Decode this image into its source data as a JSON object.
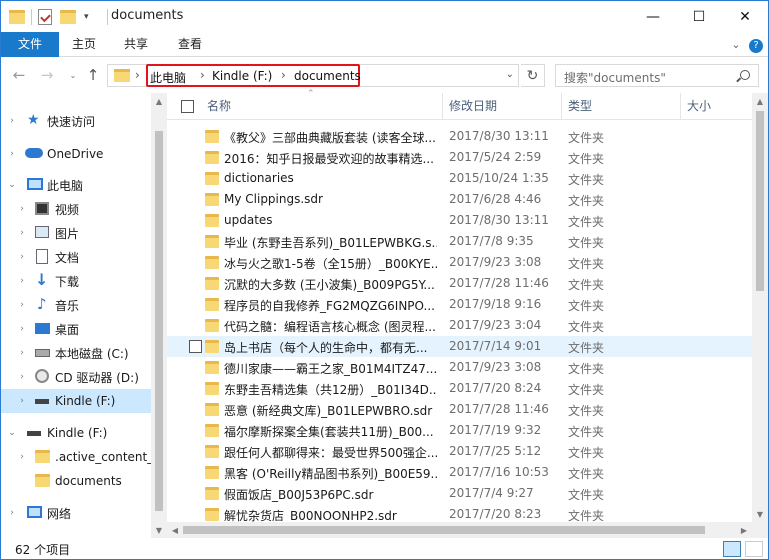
{
  "window": {
    "title": "documents",
    "minimize_glyph": "—",
    "maximize_glyph": "☐",
    "close_glyph": "✕"
  },
  "ribbon": {
    "tabs": [
      "文件",
      "主页",
      "共享",
      "查看"
    ],
    "help_glyph": "?",
    "expand_glyph": "⌄"
  },
  "address": {
    "crumbs": [
      "此电脑",
      "Kindle (F:)",
      "documents"
    ],
    "separator": "›"
  },
  "search": {
    "placeholder": "搜索\"documents\""
  },
  "navpane": {
    "items": [
      {
        "label": "快速访问",
        "icon": "star-icon"
      },
      {
        "label": "OneDrive",
        "icon": "cloud-icon"
      },
      {
        "label": "此电脑",
        "icon": "computer-icon"
      },
      {
        "label": "视频",
        "icon": "video-icon"
      },
      {
        "label": "图片",
        "icon": "picture-icon"
      },
      {
        "label": "文档",
        "icon": "document-icon"
      },
      {
        "label": "下载",
        "icon": "download-icon"
      },
      {
        "label": "音乐",
        "icon": "music-icon"
      },
      {
        "label": "桌面",
        "icon": "desktop-icon"
      },
      {
        "label": "本地磁盘 (C:)",
        "icon": "drive-icon"
      },
      {
        "label": "CD 驱动器 (D:)",
        "icon": "cd-icon"
      },
      {
        "label": "Kindle (F:)",
        "icon": "usb-drive-icon"
      },
      {
        "label": "Kindle (F:)",
        "icon": "usb-drive-icon"
      },
      {
        "label": ".active_content_s",
        "icon": "folder-icon"
      },
      {
        "label": "documents",
        "icon": "folder-icon"
      },
      {
        "label": "网络",
        "icon": "network-icon"
      }
    ]
  },
  "columns": {
    "name": "名称",
    "date": "修改日期",
    "type": "类型",
    "size": "大小"
  },
  "files": [
    {
      "name": "《教父》三部曲典藏版套装 (读客全球...",
      "date": "2017/8/30 13:11",
      "type": "文件夹"
    },
    {
      "name": "2016：知乎日报最受欢迎的故事精选...",
      "date": "2017/5/24 2:59",
      "type": "文件夹"
    },
    {
      "name": "dictionaries",
      "date": "2015/10/24 1:35",
      "type": "文件夹"
    },
    {
      "name": "My Clippings.sdr",
      "date": "2017/6/28 4:46",
      "type": "文件夹"
    },
    {
      "name": "updates",
      "date": "2017/8/30 13:11",
      "type": "文件夹"
    },
    {
      "name": "毕业 (东野圭吾系列)_B01LEPWBKG.s...",
      "date": "2017/7/8 9:35",
      "type": "文件夹"
    },
    {
      "name": "冰与火之歌1-5卷（全15册）_B00KYE...",
      "date": "2017/9/23 3:08",
      "type": "文件夹"
    },
    {
      "name": "沉默的大多数 (王小波集)_B009PG5Y...",
      "date": "2017/7/28 11:46",
      "type": "文件夹"
    },
    {
      "name": "程序员的自我修养_FG2MQZG6INPO...",
      "date": "2017/9/18 9:16",
      "type": "文件夹"
    },
    {
      "name": "代码之髓：编程语言核心概念 (图灵程...",
      "date": "2017/9/23 3:04",
      "type": "文件夹"
    },
    {
      "name": "岛上书店（每个人的生命中，都有无...",
      "date": "2017/7/14 9:01",
      "type": "文件夹"
    },
    {
      "name": "德川家康——霸王之家_B01M4ITZ47...",
      "date": "2017/9/23 3:08",
      "type": "文件夹"
    },
    {
      "name": "东野圭吾精选集（共12册）_B01I34D...",
      "date": "2017/7/20 8:24",
      "type": "文件夹"
    },
    {
      "name": "恶意 (新经典文库)_B01LEPWBRO.sdr",
      "date": "2017/7/28 11:46",
      "type": "文件夹"
    },
    {
      "name": "福尔摩斯探案全集(套装共11册)_B00...",
      "date": "2017/7/19 9:32",
      "type": "文件夹"
    },
    {
      "name": "跟任何人都聊得来：最受世界500强企...",
      "date": "2017/7/25 5:12",
      "type": "文件夹"
    },
    {
      "name": "黑客 (O'Reilly精品图书系列)_B00E59...",
      "date": "2017/7/16 10:53",
      "type": "文件夹"
    },
    {
      "name": "假面饭店_B00J53P6PC.sdr",
      "date": "2017/7/4 9:27",
      "type": "文件夹"
    },
    {
      "name": "解忧杂货店_B00NOONHP2.sdr",
      "date": "2017/7/20 8:23",
      "type": "文件夹"
    }
  ],
  "status": {
    "count": "62 个项目"
  },
  "colors": {
    "accent": "#1979ca",
    "highlight_border": "#e2141b",
    "selected": "#cce8ff",
    "hover": "#e5f3ff"
  }
}
